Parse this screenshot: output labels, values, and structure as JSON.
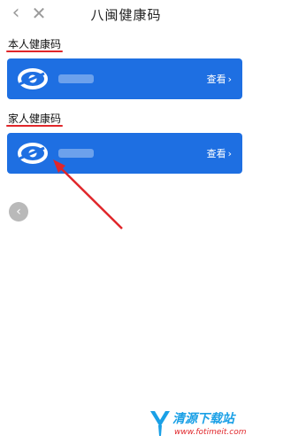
{
  "header": {
    "title": "八闽健康码",
    "back_icon": "chevron-left-icon",
    "close_icon": "close-icon"
  },
  "sections": [
    {
      "label": "本人健康码",
      "card": {
        "view_label": "查看",
        "chevron_icon": "chevron-right-icon"
      }
    },
    {
      "label": "家人健康码",
      "card": {
        "view_label": "查看",
        "chevron_icon": "chevron-right-icon"
      }
    }
  ],
  "colors": {
    "card_blue": "#1e6fe2",
    "annotation_red": "#e0262a"
  },
  "watermark": {
    "name": "清源下载站",
    "url": "www.fotimeit.com"
  }
}
